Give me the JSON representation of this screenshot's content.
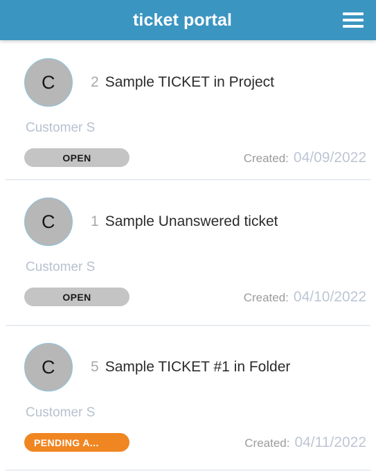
{
  "header": {
    "title": "ticket portal",
    "menu_icon": "hamburger-menu-icon",
    "background_color": "#3b95c1",
    "title_color": "#ffffff"
  },
  "colors": {
    "accent": "#3b95c1",
    "avatar_fill": "#b7b7b7",
    "avatar_ring": "#8cc3de",
    "status_open": "#c4c4c4",
    "status_pending": "#f08622",
    "muted_text": "#b7c1d0",
    "divider": "#d7dde7",
    "title_text": "#2b2b2b",
    "number_text": "#a9a9a9",
    "created_label": "#9b9b9b",
    "created_date": "#bdc6d4"
  },
  "created_label": "Created:",
  "tickets": [
    {
      "avatar_initial": "C",
      "number": "2",
      "title": "Sample TICKET in Project",
      "customer": "Customer S",
      "status": "OPEN",
      "status_kind": "open",
      "created_label": "Created:",
      "created_date": "04/09/2022"
    },
    {
      "avatar_initial": "C",
      "number": "1",
      "title": "Sample Unanswered ticket",
      "customer": "Customer S",
      "status": "OPEN",
      "status_kind": "open",
      "created_label": "Created:",
      "created_date": "04/10/2022"
    },
    {
      "avatar_initial": "C",
      "number": "5",
      "title": "Sample TICKET #1 in Folder",
      "customer": "Customer S",
      "status": "PENDING A...",
      "status_kind": "pending",
      "created_label": "Created:",
      "created_date": "04/11/2022"
    }
  ]
}
